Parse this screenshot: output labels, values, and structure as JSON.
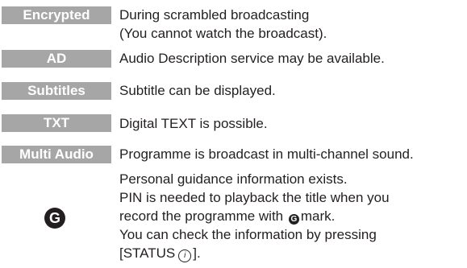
{
  "rows": [
    {
      "badge": "Encrypted",
      "lines": [
        "During scrambled broadcasting",
        "(You cannot watch the broadcast)."
      ]
    },
    {
      "badge": "AD",
      "lines": [
        "Audio Description service may be available."
      ]
    },
    {
      "badge": "Subtitles",
      "lines": [
        "Subtitle can be displayed."
      ]
    },
    {
      "badge": "TXT",
      "lines": [
        "Digital TEXT is possible."
      ]
    },
    {
      "badge": "Multi Audio",
      "lines": [
        "Programme is broadcast in multi-channel sound."
      ]
    }
  ],
  "guidance": {
    "icon": "guidance-g-icon",
    "icon_letter": "G",
    "line1": "Personal guidance information exists.",
    "line2": "PIN is needed to playback the title when you",
    "line3_before": "record the programme with",
    "line3_after": "mark.",
    "line4": "You can check the information by pressing",
    "line5_before": "[STATUS",
    "line5_icon": "info-icon",
    "line5_icon_glyph": "i",
    "line5_after": "]."
  },
  "colors": {
    "badge_background": "#a6a6a6",
    "badge_text": "#ffffff",
    "body_text": "#231f20"
  }
}
